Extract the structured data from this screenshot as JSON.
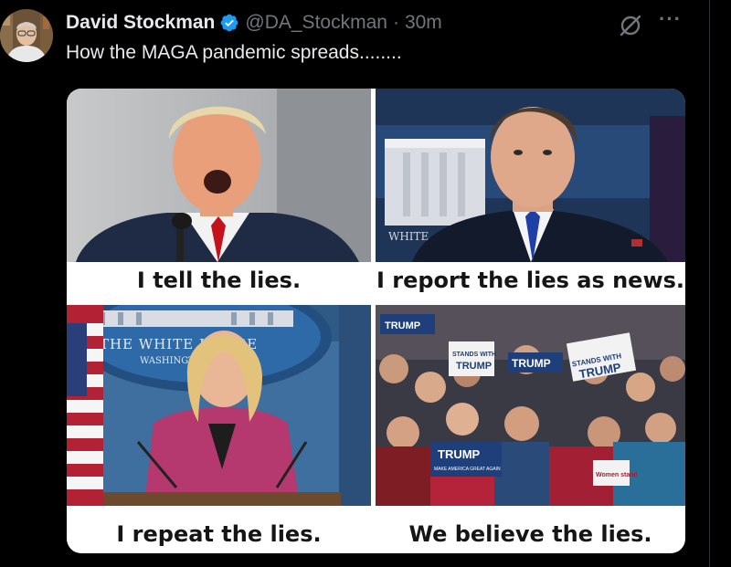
{
  "tweet": {
    "display_name": "David Stockman",
    "handle": "@DA_Stockman",
    "separator": "·",
    "time": "30m",
    "text": "How the MAGA pandemic spreads........",
    "more_label": "···"
  },
  "meme": {
    "panels": [
      {
        "caption": "I tell the lies."
      },
      {
        "caption": "I report the lies as news."
      },
      {
        "caption": "I repeat the lies."
      },
      {
        "caption": "We believe the lies."
      }
    ],
    "signs": {
      "seal_text": "THE WHITE HOUSE",
      "seal_sub": "WASHINGTON",
      "backdrop": "WHITE",
      "trump": "TRUMP",
      "stands_with": "STANDS WITH",
      "make_america": "MAKE AMERICA GREAT AGAIN",
      "women_stand": "Women stand"
    }
  },
  "colors": {
    "background": "#000000",
    "text_primary": "#e7e9ea",
    "text_secondary": "#71767b",
    "verified_blue": "#1d9bf0"
  },
  "icons": [
    "verified-badge-icon",
    "grok-icon",
    "more-options-icon"
  ]
}
